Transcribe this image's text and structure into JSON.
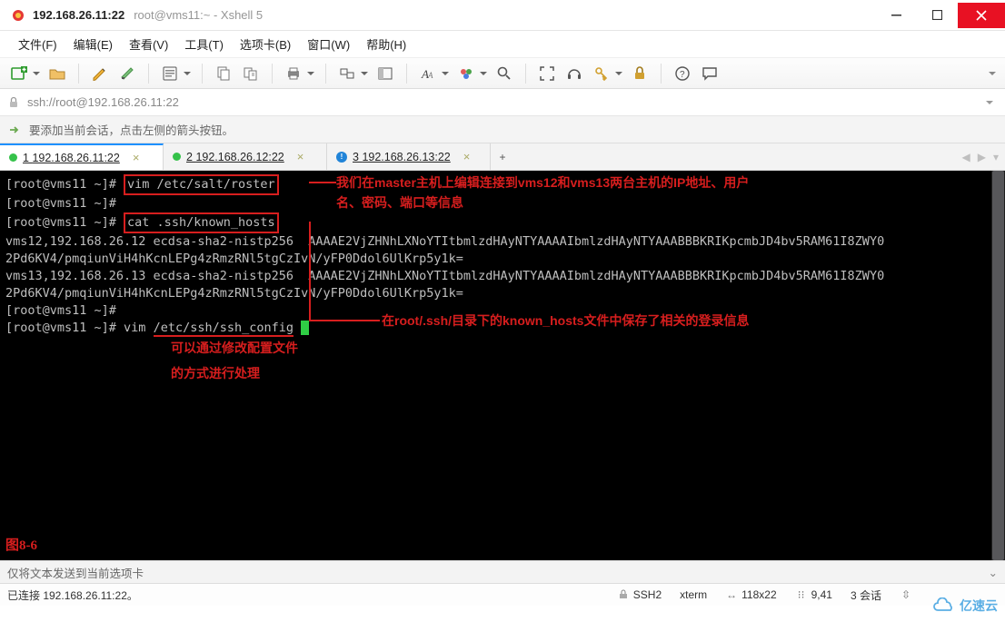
{
  "titlebar": {
    "ip_title": "192.168.26.11:22",
    "subtitle": "root@vms11:~ - Xshell 5"
  },
  "menu": {
    "file": "文件(F)",
    "edit": "编辑(E)",
    "view": "查看(V)",
    "tools": "工具(T)",
    "tabs": "选项卡(B)",
    "window": "窗口(W)",
    "help": "帮助(H)"
  },
  "address": {
    "value": "ssh://root@192.168.26.11:22"
  },
  "hint": {
    "text": "要添加当前会话，点击左侧的箭头按钮。"
  },
  "tabs": [
    {
      "index": "1",
      "label": "192.168.26.11:22",
      "status": "green",
      "active": true
    },
    {
      "index": "2",
      "label": "192.168.26.12:22",
      "status": "green",
      "active": false
    },
    {
      "index": "3",
      "label": "192.168.26.13:22",
      "status": "blue",
      "active": false
    }
  ],
  "newtab_label": "+",
  "terminal": {
    "prompt": "[root@vms11 ~]# ",
    "prompt_empty": "[root@vms11 ~]#",
    "cmd_vim_roster": "vim /etc/salt/roster",
    "cmd_cat_known": "cat .ssh/known_hosts",
    "known_host_1_a": "vms12,192.168.26.12 ecdsa-sha2-nistp256  AAAAE2VjZHNhLXNoYTItbmlzdHAyNTYAAAAIbmlzdHAyNTYAAABBBKRIKpcmbJD4bv5RAM61I8ZWY0",
    "known_host_1_b": "2Pd6KV4/pmqiunViH4hKcnLEPg4zRmzRNl5tgCzIvN/yFP0Ddol6UlKrp5y1k=",
    "known_host_2_a": "vms13,192.168.26.13 ecdsa-sha2-nistp256  AAAAE2VjZHNhLXNoYTItbmlzdHAyNTYAAAAIbmlzdHAyNTYAAABBBKRIKpcmbJD4bv5RAM61I8ZWY0",
    "known_host_2_b": "2Pd6KV4/pmqiunViH4hKcnLEPg4zRmzRNl5tgCzIvN/yFP0Ddol6UlKrp5y1k=",
    "cmd_vim_part_plain": "vim ",
    "cmd_vim_part_underlined": "/etc/ssh/ssh_config",
    "figure_label": "图8-6"
  },
  "annotations": {
    "a1_line1": "我们在master主机上编辑连接到vms12和vms13两台主机的IP地址、用户",
    "a1_line2": "名、密码、端口等信息",
    "a2": "在root/.ssh/目录下的known_hosts文件中保存了相关的登录信息",
    "a3_line1": "可以通过修改配置文件",
    "a3_line2": "的方式进行处理"
  },
  "sendbar": {
    "text": "仅将文本发送到当前选项卡"
  },
  "status": {
    "connected": "已连接 192.168.26.11:22。",
    "ssh": "SSH2",
    "term": "xterm",
    "size": "118x22",
    "cursor_pos": "9,41",
    "sessions": "3 会话"
  },
  "watermark": {
    "text": "亿速云"
  },
  "icon_names": {
    "new": "new-session-icon",
    "open": "open-icon",
    "compose": "compose-icon",
    "paste": "paste-icon",
    "search": "search-icon",
    "copy": "copy-icon",
    "print": "print-icon",
    "sessions": "sessions-icon",
    "sidebar": "sidebar-icon",
    "font": "font-icon",
    "color": "color-icon",
    "zoom": "zoom-icon",
    "fullscreen": "fullscreen-icon",
    "headset": "headset-icon",
    "lockkey": "key-lock-icon",
    "lock": "lock-icon",
    "help": "help-icon",
    "chat": "chat-icon"
  }
}
